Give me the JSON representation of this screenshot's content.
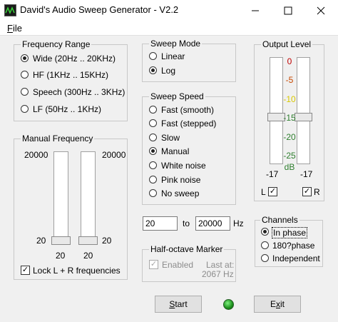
{
  "window": {
    "title": "David's Audio Sweep Generator - V2.2",
    "icons": {
      "app": "waveform-icon",
      "minimize": "minimize-icon",
      "maximize": "maximize-icon",
      "close": "close-icon"
    }
  },
  "menu": {
    "file_mnemonic": "F",
    "file_rest": "ile"
  },
  "frequency_range": {
    "label": "Frequency Range",
    "options": [
      {
        "label": "Wide  (20Hz .. 20KHz)",
        "selected": true
      },
      {
        "label": "HF  (1KHz .. 15KHz)",
        "selected": false
      },
      {
        "label": "Speech  (300Hz .. 3KHz)",
        "selected": false
      },
      {
        "label": "LF  (50Hz .. 1KHz)",
        "selected": false
      }
    ]
  },
  "manual_frequency": {
    "label": "Manual Frequency",
    "left_top": "20000",
    "right_top": "20000",
    "left_bottom": "20",
    "right_bottom": "20",
    "left_value": "20",
    "right_value": "20",
    "lock_label": "Lock L + R frequencies",
    "lock_checked": true
  },
  "sweep_mode": {
    "label": "Sweep Mode",
    "options": [
      {
        "label": "Linear",
        "selected": false
      },
      {
        "label": "Log",
        "selected": true
      }
    ]
  },
  "sweep_speed": {
    "label": "Sweep Speed",
    "options": [
      {
        "label": "Fast (smooth)",
        "selected": false
      },
      {
        "label": "Fast (stepped)",
        "selected": false
      },
      {
        "label": "Slow",
        "selected": false
      },
      {
        "label": "Manual",
        "selected": true
      },
      {
        "label": "White noise",
        "selected": false
      },
      {
        "label": "Pink noise",
        "selected": false
      },
      {
        "label": "No sweep",
        "selected": false
      }
    ]
  },
  "range_inputs": {
    "from": "20",
    "to_label": "to",
    "to": "20000",
    "unit": "Hz"
  },
  "half_octave": {
    "label": "Half-octave Marker",
    "enabled_label": "Enabled",
    "enabled_checked": true,
    "last_at_line1": "Last at:",
    "last_at_line2": "2067 Hz"
  },
  "output_level": {
    "label": "Output Level",
    "scale": [
      "0",
      "-5",
      "-10",
      "-15",
      "-20",
      "-25"
    ],
    "scale_colors": [
      "#c00000",
      "#c84800",
      "#d8c800",
      "#2f7f2f",
      "#2f7f2f",
      "#2f7f2f"
    ],
    "unit": "dB",
    "left_value": "-17",
    "right_value": "-17",
    "left_check_label": "L",
    "right_check_label": "R",
    "left_checked": true,
    "right_checked": true,
    "left_level_db": -17,
    "right_level_db": -17
  },
  "channels": {
    "label": "Channels",
    "options": [
      {
        "label": "In phase",
        "selected": true
      },
      {
        "label": "180?phase",
        "selected": false
      },
      {
        "label": "Independent",
        "selected": false
      }
    ]
  },
  "buttons": {
    "start_mnemonic": "S",
    "start_rest": "tart",
    "exit_prefix": "E",
    "exit_mnemonic": "x",
    "exit_rest": "it"
  },
  "status": {
    "running_led_color": "#22aa22"
  }
}
